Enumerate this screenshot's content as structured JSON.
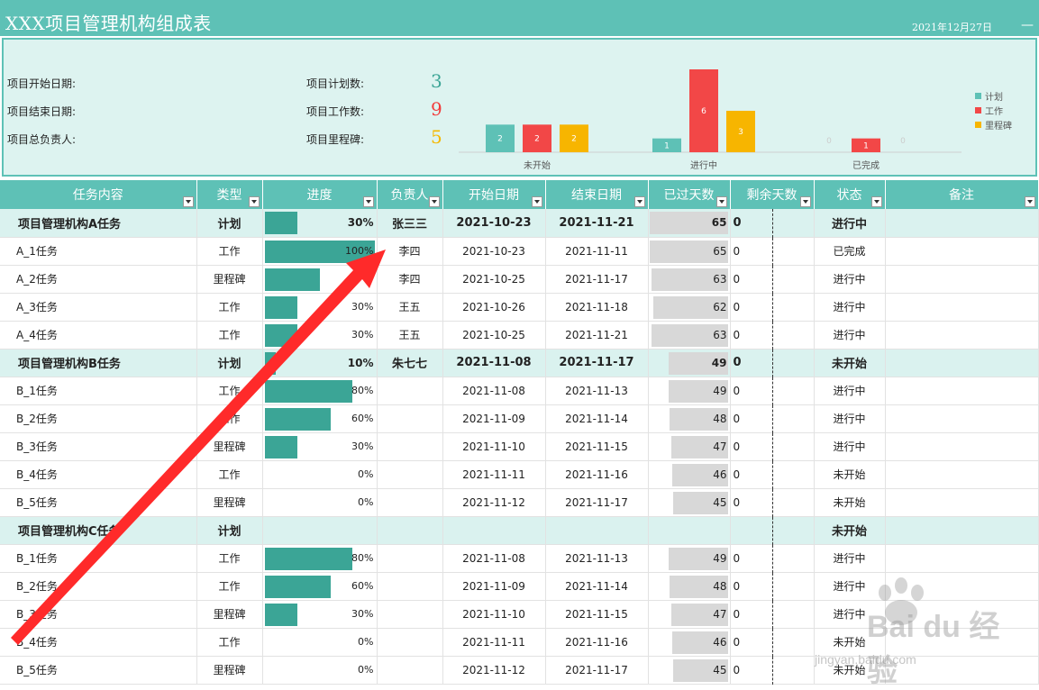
{
  "header": {
    "title": "XXX项目管理机构组成表",
    "date": "2021年12月27日",
    "dash": "—"
  },
  "summary": {
    "start_label": "项目开始日期:",
    "end_label": "项目结束日期:",
    "owner_label": "项目总负责人:",
    "plan_label": "项目计划数:",
    "plan_value": "3",
    "work_label": "项目工作数:",
    "work_value": "9",
    "milestone_label": "项目里程碑:",
    "milestone_value": "5",
    "colors": {
      "plan": "#3ba596",
      "work": "#f23a3a",
      "milestone": "#f5b800"
    }
  },
  "chart_data": {
    "type": "bar",
    "categories": [
      "未开始",
      "进行中",
      "已完成"
    ],
    "series": [
      {
        "name": "计划",
        "values": [
          2,
          1,
          0
        ],
        "color": "#5ec1b6"
      },
      {
        "name": "工作",
        "values": [
          2,
          6,
          1
        ],
        "color": "#f24747"
      },
      {
        "name": "里程碑",
        "values": [
          2,
          3,
          0
        ],
        "color": "#f7b500"
      }
    ],
    "ylim": [
      0,
      6
    ],
    "legend": "right"
  },
  "table": {
    "columns": [
      "任务内容",
      "类型",
      "进度",
      "负责人",
      "开始日期",
      "结束日期",
      "已过天数",
      "剩余天数",
      "状态",
      "备注"
    ],
    "rows": [
      {
        "group": true,
        "name": "项目管理机构A任务",
        "type": "计划",
        "progress": 30,
        "progress_text": "30%",
        "owner": "张三三",
        "start": "2021-10-23",
        "end": "2021-11-21",
        "elapsed": 65,
        "remain": "0",
        "status": "进行中"
      },
      {
        "group": false,
        "name": "A_1任务",
        "type": "工作",
        "progress": 100,
        "progress_text": "100%",
        "owner": "李四",
        "start": "2021-10-23",
        "end": "2021-11-11",
        "elapsed": 65,
        "remain": "0",
        "status": "已完成"
      },
      {
        "group": false,
        "name": "A_2任务",
        "type": "里程碑",
        "progress": 50,
        "progress_text": "",
        "owner": "李四",
        "start": "2021-10-25",
        "end": "2021-11-17",
        "elapsed": 63,
        "remain": "0",
        "status": "进行中"
      },
      {
        "group": false,
        "name": "A_3任务",
        "type": "工作",
        "progress": 30,
        "progress_text": "30%",
        "owner": "王五",
        "start": "2021-10-26",
        "end": "2021-11-18",
        "elapsed": 62,
        "remain": "0",
        "status": "进行中"
      },
      {
        "group": false,
        "name": "A_4任务",
        "type": "工作",
        "progress": 30,
        "progress_text": "30%",
        "owner": "王五",
        "start": "2021-10-25",
        "end": "2021-11-21",
        "elapsed": 63,
        "remain": "0",
        "status": "进行中"
      },
      {
        "group": true,
        "name": "项目管理机构B任务",
        "type": "计划",
        "progress": 10,
        "progress_text": "10%",
        "owner": "朱七七",
        "start": "2021-11-08",
        "end": "2021-11-17",
        "elapsed": 49,
        "remain": "0",
        "status": "未开始"
      },
      {
        "group": false,
        "name": "B_1任务",
        "type": "工作",
        "progress": 80,
        "progress_text": "80%",
        "owner": "",
        "start": "2021-11-08",
        "end": "2021-11-13",
        "elapsed": 49,
        "remain": "0",
        "status": "进行中"
      },
      {
        "group": false,
        "name": "B_2任务",
        "type": "工作",
        "progress": 60,
        "progress_text": "60%",
        "owner": "",
        "start": "2021-11-09",
        "end": "2021-11-14",
        "elapsed": 48,
        "remain": "0",
        "status": "进行中"
      },
      {
        "group": false,
        "name": "B_3任务",
        "type": "里程碑",
        "progress": 30,
        "progress_text": "30%",
        "owner": "",
        "start": "2021-11-10",
        "end": "2021-11-15",
        "elapsed": 47,
        "remain": "0",
        "status": "进行中"
      },
      {
        "group": false,
        "name": "B_4任务",
        "type": "工作",
        "progress": 0,
        "progress_text": "0%",
        "owner": "",
        "start": "2021-11-11",
        "end": "2021-11-16",
        "elapsed": 46,
        "remain": "0",
        "status": "未开始"
      },
      {
        "group": false,
        "name": "B_5任务",
        "type": "里程碑",
        "progress": 0,
        "progress_text": "0%",
        "owner": "",
        "start": "2021-11-12",
        "end": "2021-11-17",
        "elapsed": 45,
        "remain": "0",
        "status": "未开始"
      },
      {
        "group": true,
        "name": "项目管理机构C任务",
        "type": "计划",
        "progress": 0,
        "progress_text": "",
        "owner": "",
        "start": "",
        "end": "",
        "elapsed": 0,
        "remain": "",
        "status": "未开始"
      },
      {
        "group": false,
        "name": "B_1任务",
        "type": "工作",
        "progress": 80,
        "progress_text": "80%",
        "owner": "",
        "start": "2021-11-08",
        "end": "2021-11-13",
        "elapsed": 49,
        "remain": "0",
        "status": "进行中"
      },
      {
        "group": false,
        "name": "B_2任务",
        "type": "工作",
        "progress": 60,
        "progress_text": "60%",
        "owner": "",
        "start": "2021-11-09",
        "end": "2021-11-14",
        "elapsed": 48,
        "remain": "0",
        "status": "进行中"
      },
      {
        "group": false,
        "name": "B_3任务",
        "type": "里程碑",
        "progress": 30,
        "progress_text": "30%",
        "owner": "",
        "start": "2021-11-10",
        "end": "2021-11-15",
        "elapsed": 47,
        "remain": "0",
        "status": "进行中"
      },
      {
        "group": false,
        "name": "B_4任务",
        "type": "工作",
        "progress": 0,
        "progress_text": "0%",
        "owner": "",
        "start": "2021-11-11",
        "end": "2021-11-16",
        "elapsed": 46,
        "remain": "0",
        "status": "未开始"
      },
      {
        "group": false,
        "name": "B_5任务",
        "type": "里程碑",
        "progress": 0,
        "progress_text": "0%",
        "owner": "",
        "start": "2021-11-12",
        "end": "2021-11-17",
        "elapsed": 45,
        "remain": "0",
        "status": "未开始"
      }
    ]
  },
  "watermark": {
    "brand": "Bai du 经验",
    "sub": "jingyan.baidu.com"
  },
  "annotation": {
    "arrow_color": "#ff2a2a"
  }
}
